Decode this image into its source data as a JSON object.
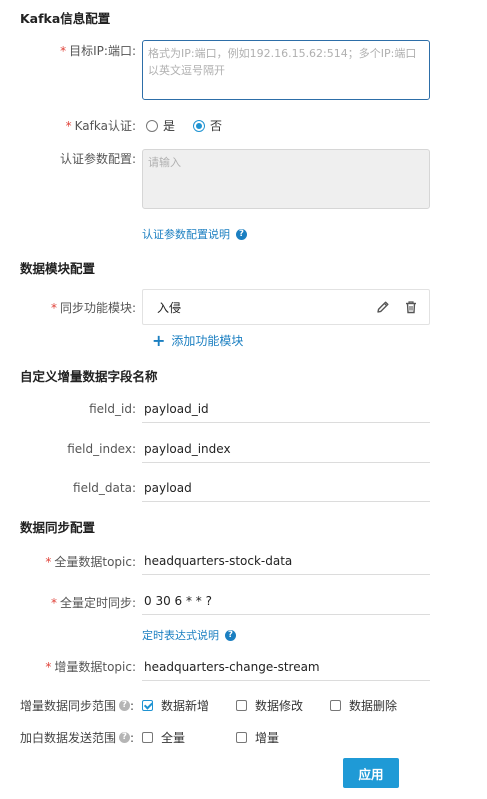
{
  "kafka": {
    "section_title": "Kafka信息配置",
    "target_label": "目标IP:端口:",
    "target_placeholder": "格式为IP:端口，例如192.16.15.62:514；多个IP:端口以英文逗号隔开",
    "auth_label": "Kafka认证:",
    "auth_options": [
      {
        "label": "是",
        "checked": false
      },
      {
        "label": "否",
        "checked": true
      }
    ],
    "auth_param_label": "认证参数配置:",
    "auth_param_placeholder": "请输入",
    "auth_help_link": "认证参数配置说明",
    "help_icon_char": "?"
  },
  "module": {
    "section_title": "数据模块配置",
    "sync_label": "同步功能模块:",
    "items": [
      {
        "name": "入侵"
      }
    ],
    "add_label": "添加功能模块",
    "add_icon_char": "+"
  },
  "custom_fields": {
    "section_title": "自定义增量数据字段名称",
    "fields": [
      {
        "label": "field_id:",
        "value": "payload_id"
      },
      {
        "label": "field_index:",
        "value": "payload_index"
      },
      {
        "label": "field_data:",
        "value": "payload"
      }
    ]
  },
  "sync": {
    "section_title": "数据同步配置",
    "full_topic_label": "全量数据topic:",
    "full_topic_value": "headquarters-stock-data",
    "schedule_label": "全量定时同步:",
    "schedule_value": "0 30 6 * * ?",
    "cron_help_link": "定时表达式说明",
    "inc_topic_label": "增量数据topic:",
    "inc_topic_value": "headquarters-change-stream",
    "inc_scope_label": "增量数据同步范围",
    "inc_scope_options": [
      {
        "label": "数据新增",
        "checked": true
      },
      {
        "label": "数据修改",
        "checked": false
      },
      {
        "label": "数据删除",
        "checked": false
      }
    ],
    "whitelist_label": "加白数据发送范围",
    "whitelist_options": [
      {
        "label": "全量",
        "checked": false
      },
      {
        "label": "增量",
        "checked": false
      }
    ],
    "colon": ":"
  },
  "actions": {
    "apply_label": "应用"
  },
  "required_mark": "*",
  "colors": {
    "accent": "#1f9ad6",
    "link": "#1b7fc1",
    "required": "#e0433a"
  }
}
